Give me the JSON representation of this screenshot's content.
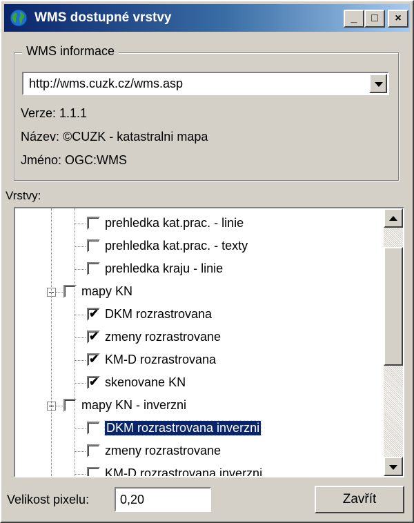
{
  "window": {
    "title": "WMS dostupné vrstvy",
    "controls": {
      "minimize": "_",
      "maximize": "□",
      "close": "×"
    }
  },
  "wms_info": {
    "group_title": "WMS informace",
    "url": "http://wms.cuzk.cz/wms.asp",
    "version_line": "Verze: 1.1.1",
    "name_line": "Název: ©CUZK - katastralni mapa",
    "id_line": "Jméno: OGC:WMS"
  },
  "layers": {
    "label": "Vrstvy:",
    "items": [
      {
        "label": "prehledka kat.prac. - linie",
        "checked": false
      },
      {
        "label": "prehledka kat.prac. - texty",
        "checked": false
      },
      {
        "label": "prehledka kraju - linie",
        "checked": false
      },
      {
        "label": "mapy KN",
        "checked": false,
        "group": true
      },
      {
        "label": "DKM rozrastrovana",
        "checked": true
      },
      {
        "label": "zmeny rozrastrovane",
        "checked": true
      },
      {
        "label": "KM-D rozrastrovana",
        "checked": true
      },
      {
        "label": "skenovane KN",
        "checked": true
      },
      {
        "label": "mapy KN - inverzni",
        "checked": false,
        "group": true
      },
      {
        "label": "DKM rozrastrovana inverzni",
        "checked": false,
        "selected": true
      },
      {
        "label": "zmeny rozrastrovane",
        "checked": false
      },
      {
        "label": "KM-D rozrastrovana inverzni",
        "checked": false
      }
    ]
  },
  "footer": {
    "pixel_label": "Velikost pixelu:",
    "pixel_value": "0,20",
    "close_label": "Zavřít"
  },
  "icons": {
    "app": "globe-icon",
    "checkmark": "✔"
  }
}
